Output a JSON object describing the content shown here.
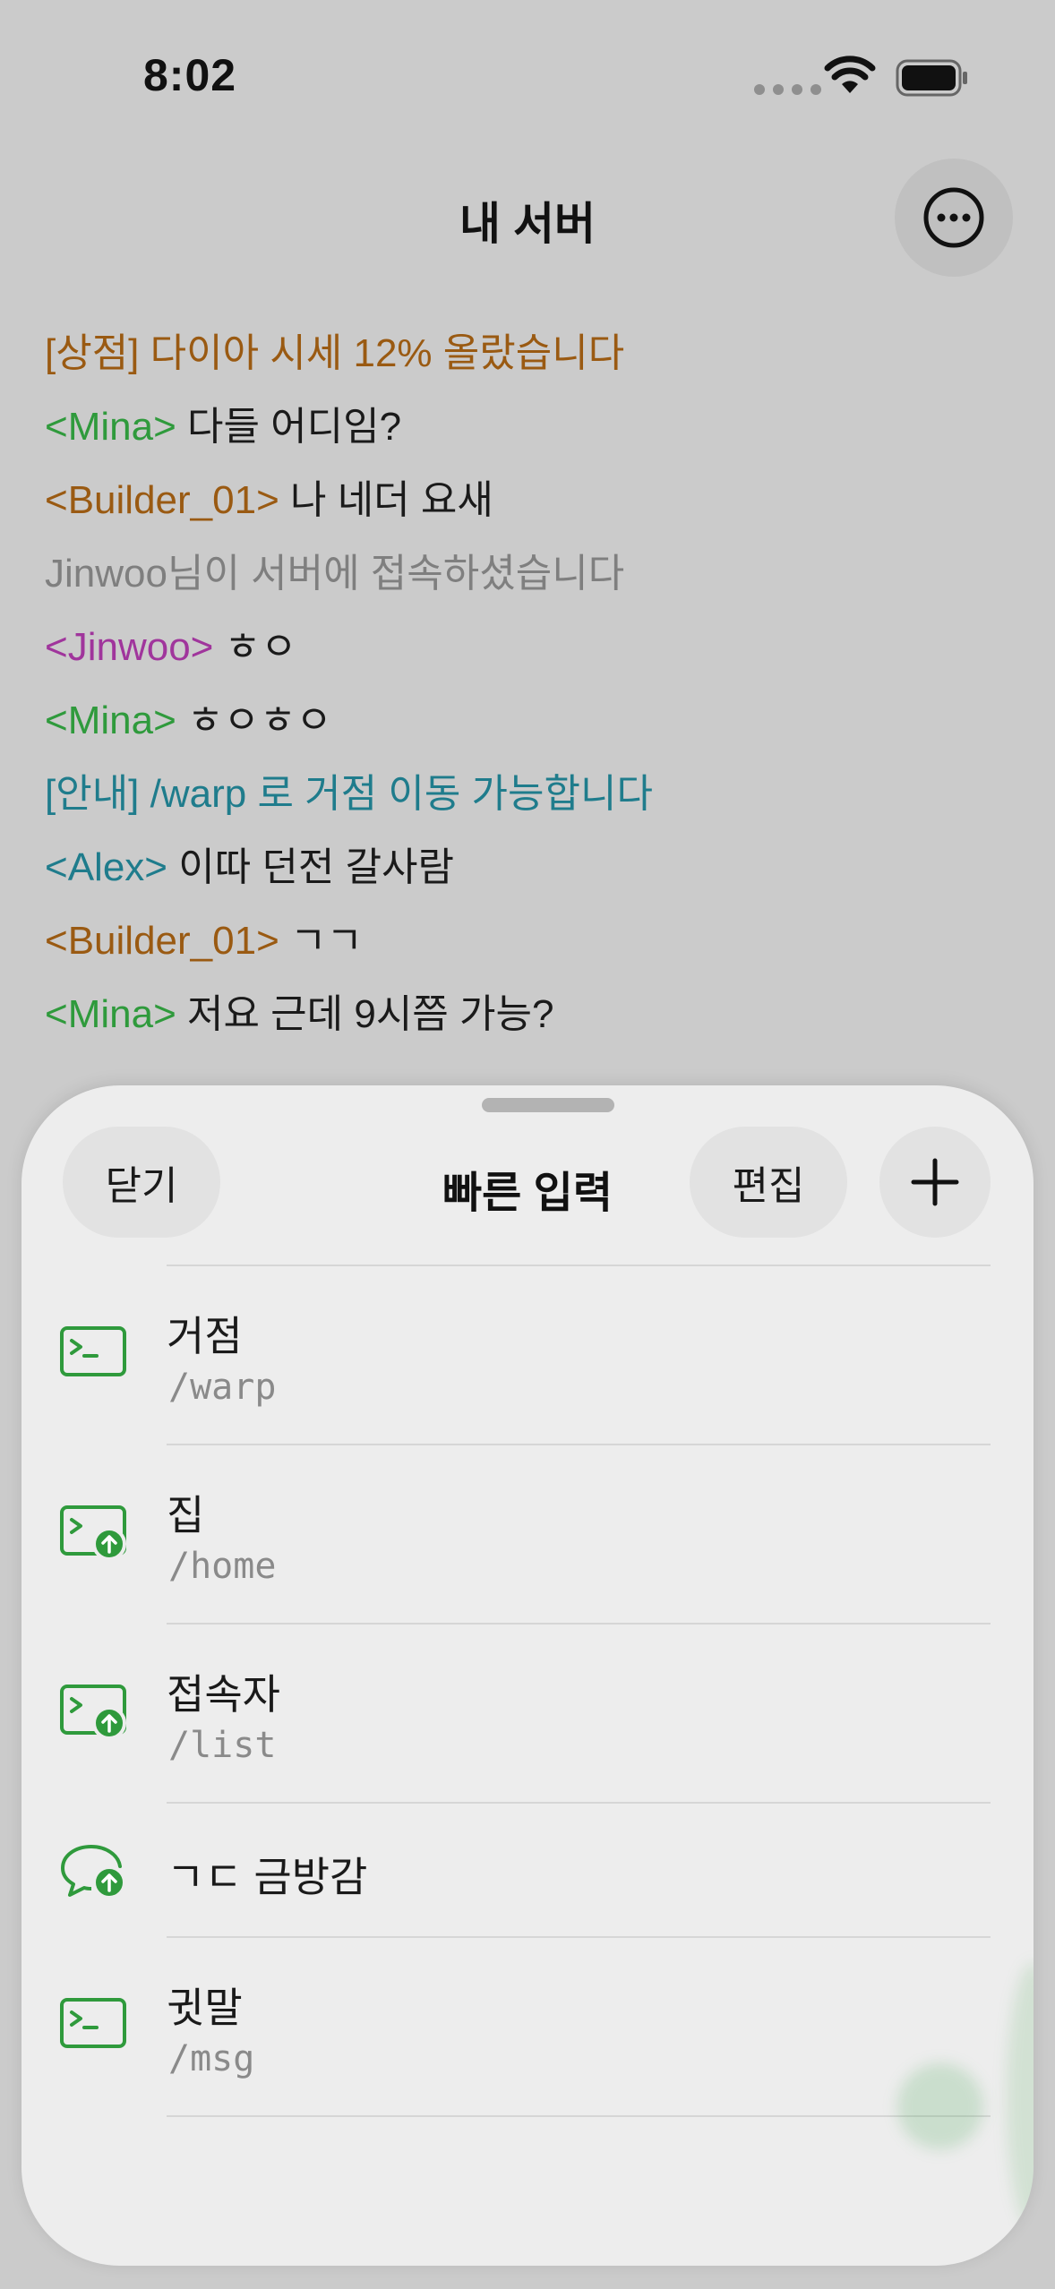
{
  "status_bar": {
    "time": "8:02"
  },
  "header": {
    "title": "내 서버"
  },
  "chat": {
    "messages": [
      {
        "speaker": "",
        "speaker_color": "",
        "text": "[상점] 다이아 시세 12% 올랐습니다",
        "text_color": "#9a5a12"
      },
      {
        "speaker": "<Mina>",
        "speaker_color": "#2f9a3c",
        "text": " 다들 어디임?",
        "text_color": "#1a1a1a"
      },
      {
        "speaker": "<Builder_01>",
        "speaker_color": "#9a5a12",
        "text": " 나 네더 요새",
        "text_color": "#1a1a1a"
      },
      {
        "speaker": "",
        "speaker_color": "",
        "text": "Jinwoo님이 서버에 접속하셨습니다",
        "text_color": "#7f7f7f"
      },
      {
        "speaker": "<Jinwoo>",
        "speaker_color": "#a0359c",
        "text": " ㅎㅇ",
        "text_color": "#1a1a1a"
      },
      {
        "speaker": "<Mina>",
        "speaker_color": "#2f9a3c",
        "text": " ㅎㅇㅎㅇ",
        "text_color": "#1a1a1a"
      },
      {
        "speaker": "",
        "speaker_color": "",
        "text": "[안내] /warp 로 거점 이동 가능합니다",
        "text_color": "#1f7c8c"
      },
      {
        "speaker": "<Alex>",
        "speaker_color": "#1f7c8c",
        "text": " 이따 던전 갈사람",
        "text_color": "#1a1a1a"
      },
      {
        "speaker": "<Builder_01>",
        "speaker_color": "#9a5a12",
        "text": " ㄱㄱ",
        "text_color": "#1a1a1a"
      },
      {
        "speaker": "<Mina>",
        "speaker_color": "#2f9a3c",
        "text": " 저요 근데 9시쯤 가능?",
        "text_color": "#1a1a1a"
      }
    ]
  },
  "sheet": {
    "close_label": "닫기",
    "title": "빠른 입력",
    "edit_label": "편집",
    "accent_color": "#2f9a3c",
    "items": [
      {
        "title": "거점",
        "command": "/warp",
        "icon": "terminal-icon"
      },
      {
        "title": "집",
        "command": "/home",
        "icon": "terminal-upload-icon"
      },
      {
        "title": "접속자",
        "command": "/list",
        "icon": "terminal-upload-icon"
      },
      {
        "title": "ㄱㄷ  금방감",
        "command": "",
        "icon": "chat-bubble-upload-icon"
      },
      {
        "title": "귓말",
        "command": "/msg",
        "icon": "terminal-icon"
      }
    ]
  }
}
